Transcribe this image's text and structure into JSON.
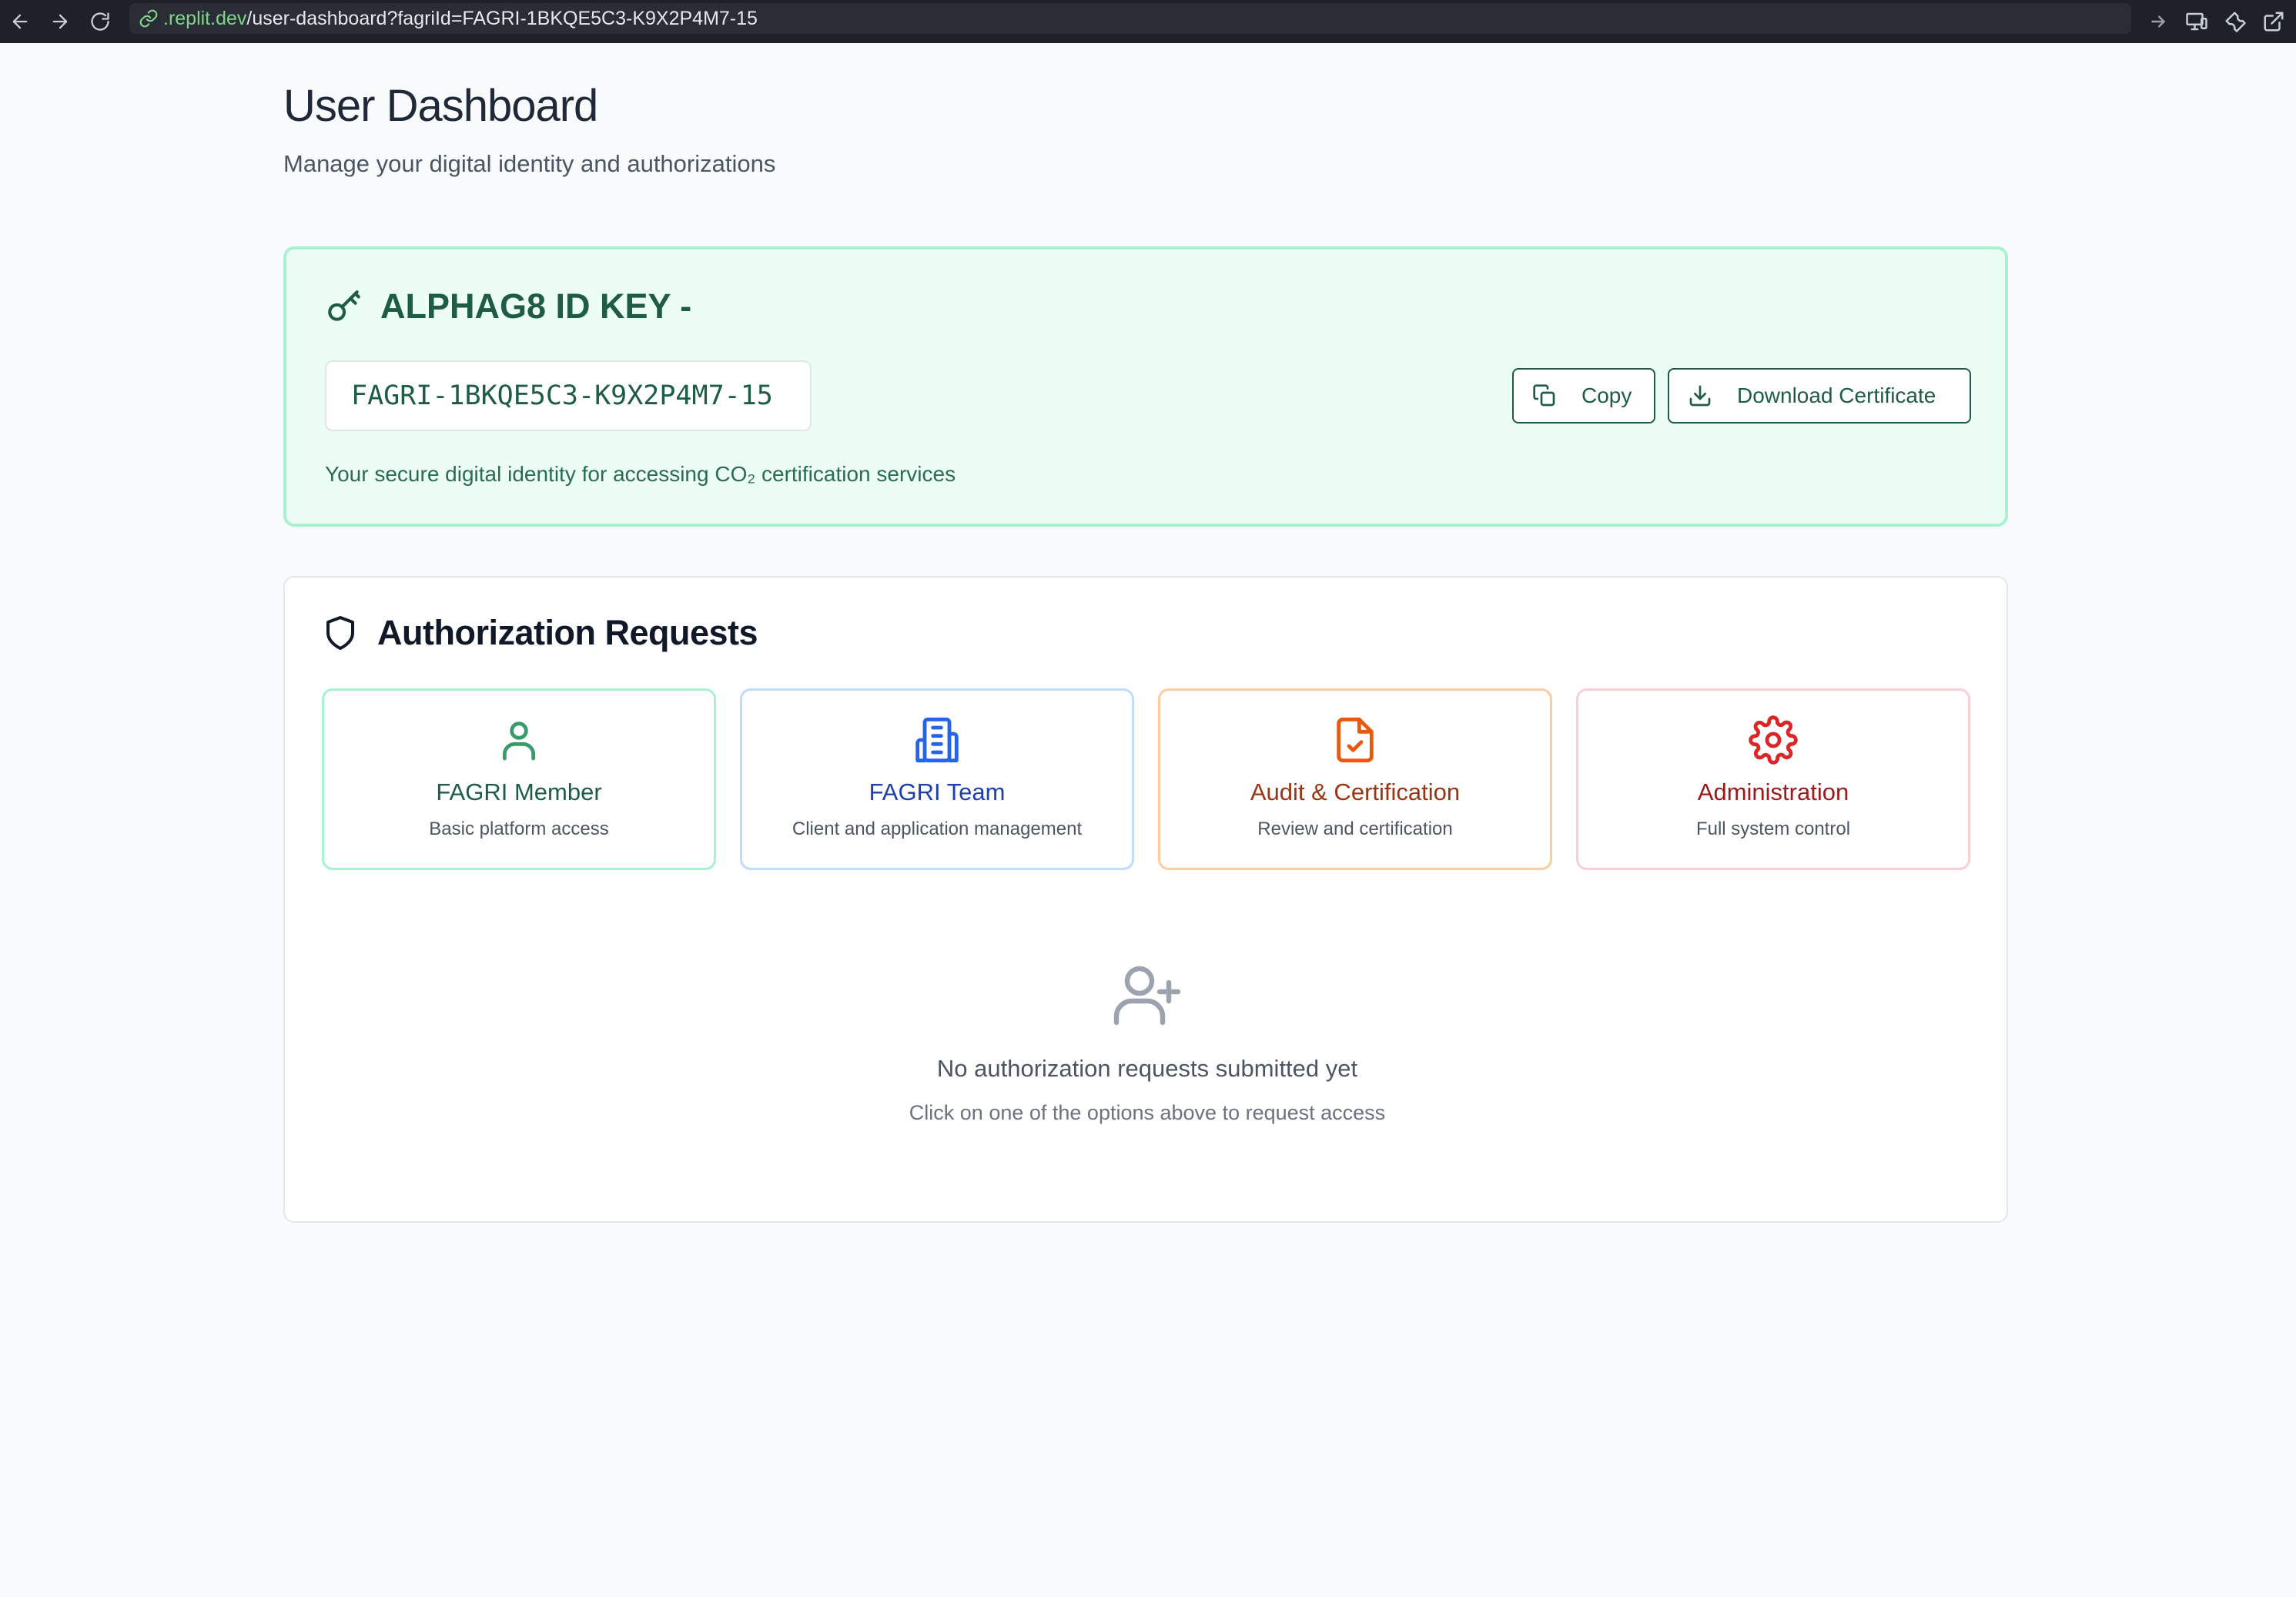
{
  "browser": {
    "url_host": ".replit.dev",
    "url_path": "/user-dashboard?fagriId=FAGRI-1BKQE5C3-K9X2P4M7-15"
  },
  "page": {
    "title": "User Dashboard",
    "subtitle": "Manage your digital identity and authorizations"
  },
  "id_card": {
    "title": "ALPHAG8 ID KEY -",
    "key_value": "FAGRI-1BKQE5C3-K9X2P4M7-15",
    "copy_label": "Copy",
    "download_label": "Download Certificate",
    "note": "Your secure digital identity for accessing CO₂ certification services",
    "accent_color": "#1f5c45",
    "background_color": "#ecfdf5"
  },
  "authorization": {
    "title": "Authorization Requests",
    "options": [
      {
        "name": "FAGRI Member",
        "description": "Basic platform access",
        "icon": "user-icon",
        "color": "#3b9a6c"
      },
      {
        "name": "FAGRI Team",
        "description": "Client and application management",
        "icon": "building-icon",
        "color": "#2563eb"
      },
      {
        "name": "Audit & Certification",
        "description": "Review and certification",
        "icon": "file-check-icon",
        "color": "#ea580c"
      },
      {
        "name": "Administration",
        "description": "Full system control",
        "icon": "gear-icon",
        "color": "#dc2626"
      }
    ],
    "empty_title": "No authorization requests submitted yet",
    "empty_subtitle": "Click on one of the options above to request access"
  }
}
